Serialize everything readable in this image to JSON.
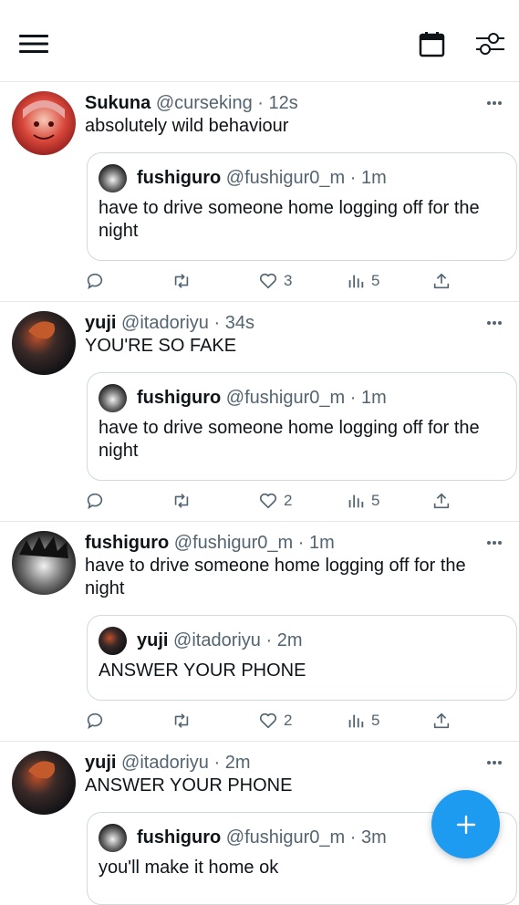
{
  "header": {
    "icons": [
      "menu-icon",
      "calendar-icon",
      "filter-icon"
    ]
  },
  "tweets": [
    {
      "name": "Sukuna",
      "handle": "@curseking",
      "sep": "·",
      "time": "12s",
      "text": "absolutely wild behaviour",
      "quote": {
        "name": "fushiguro",
        "handle": "@fushigur0_m",
        "sep": "·",
        "time": "1m",
        "text": "have to drive someone home logging off for the night"
      },
      "stats": {
        "replies": "",
        "retweets": "",
        "likes": "3",
        "views": "5"
      }
    },
    {
      "name": "yuji",
      "handle": "@itadoriyu",
      "sep": "·",
      "time": "34s",
      "text": "YOU'RE SO FAKE",
      "quote": {
        "name": "fushiguro",
        "handle": "@fushigur0_m",
        "sep": "·",
        "time": "1m",
        "text": "have to drive someone home logging off for the night"
      },
      "stats": {
        "replies": "",
        "retweets": "",
        "likes": "2",
        "views": "5"
      }
    },
    {
      "name": "fushiguro",
      "handle": "@fushigur0_m",
      "sep": "·",
      "time": "1m",
      "text": "have to drive someone home logging off for the night",
      "quote": {
        "name": "yuji",
        "handle": "@itadoriyu",
        "sep": "·",
        "time": "2m",
        "text": "ANSWER YOUR PHONE"
      },
      "stats": {
        "replies": "",
        "retweets": "",
        "likes": "2",
        "views": "5"
      }
    },
    {
      "name": "yuji",
      "handle": "@itadoriyu",
      "sep": "·",
      "time": "2m",
      "text": "ANSWER YOUR PHONE",
      "quote": {
        "name": "fushiguro",
        "handle": "@fushigur0_m",
        "sep": "·",
        "time": "3m",
        "text": "you'll make it home ok"
      }
    }
  ],
  "fab": {
    "icon": "plus-icon",
    "color": "#1d9bf0"
  }
}
